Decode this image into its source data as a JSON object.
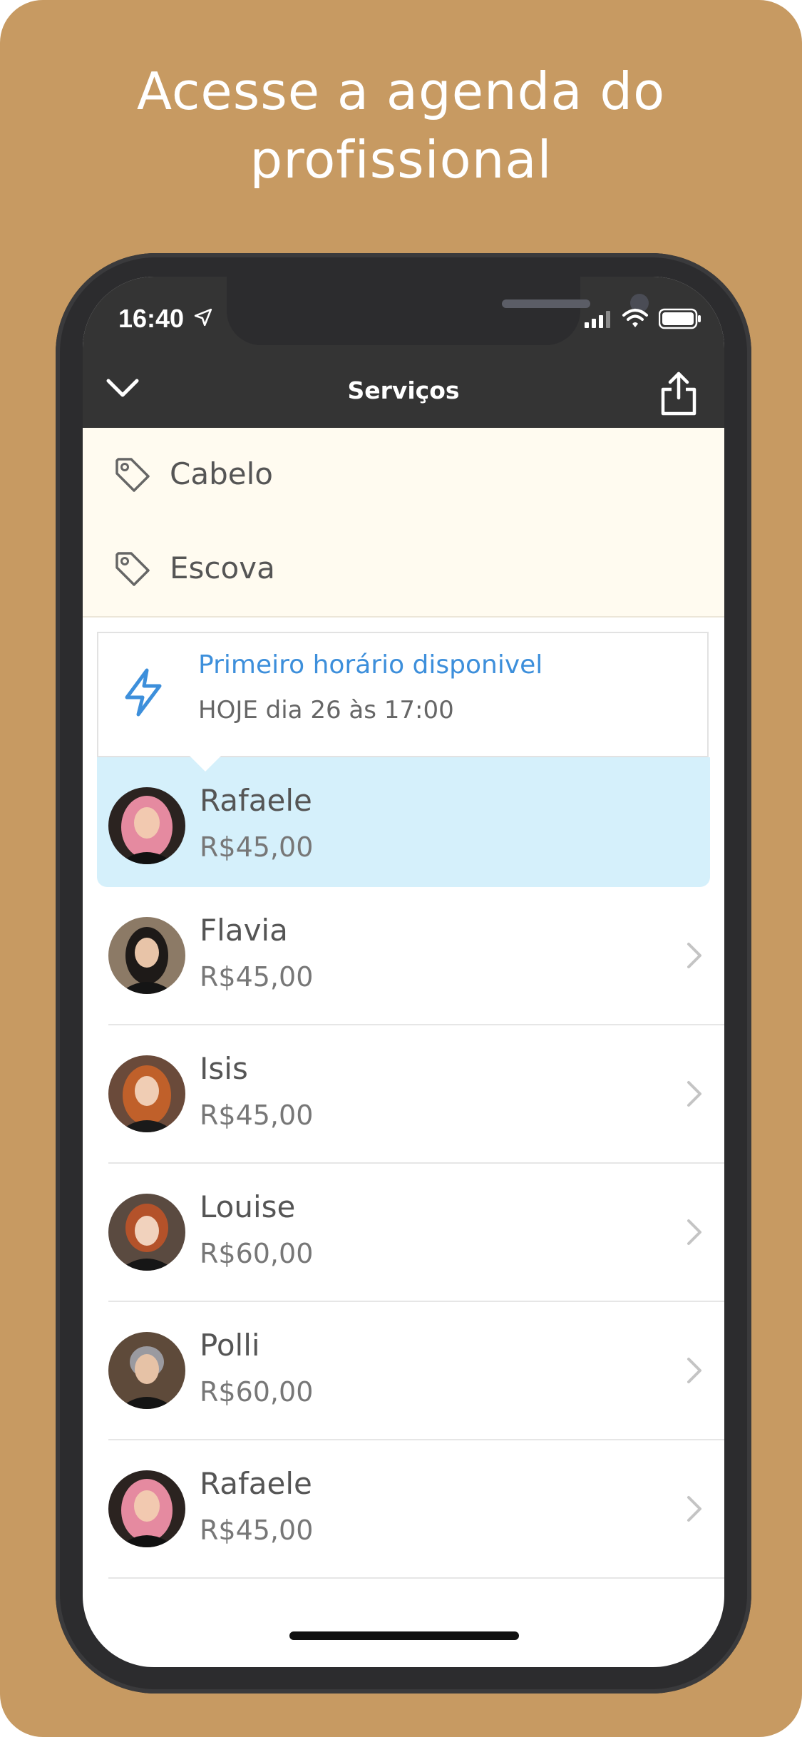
{
  "headline": {
    "line1": "Acesse a agenda do",
    "line2": "profissional"
  },
  "status_bar": {
    "time": "16:40",
    "icons": [
      "location-arrow-icon",
      "signal-icon",
      "wifi-icon",
      "battery-icon"
    ]
  },
  "nav": {
    "title": "Serviços",
    "back_icon": "chevron-down-icon",
    "share_icon": "share-icon"
  },
  "categories": [
    {
      "label": "Cabelo",
      "icon": "tag-icon"
    },
    {
      "label": "Escova",
      "icon": "tag-icon"
    }
  ],
  "first_available": {
    "icon": "lightning-bolt-icon",
    "title": "Primeiro horário disponivel",
    "subtitle": "HOJE dia 26 às 17:00"
  },
  "professionals": [
    {
      "name": "Rafaele",
      "price": "R$45,00",
      "selected": true
    },
    {
      "name": "Flavia",
      "price": "R$45,00",
      "selected": false
    },
    {
      "name": "Isis",
      "price": "R$45,00",
      "selected": false
    },
    {
      "name": "Louise",
      "price": "R$60,00",
      "selected": false
    },
    {
      "name": "Polli",
      "price": "R$60,00",
      "selected": false
    },
    {
      "name": "Rafaele",
      "price": "R$45,00",
      "selected": false
    }
  ],
  "colors": {
    "background": "#C79A62",
    "accent_blue": "#3D8FDB",
    "selected_row": "#D5F0FB",
    "category_bg": "#FFFBF0",
    "navbar": "#343434"
  }
}
